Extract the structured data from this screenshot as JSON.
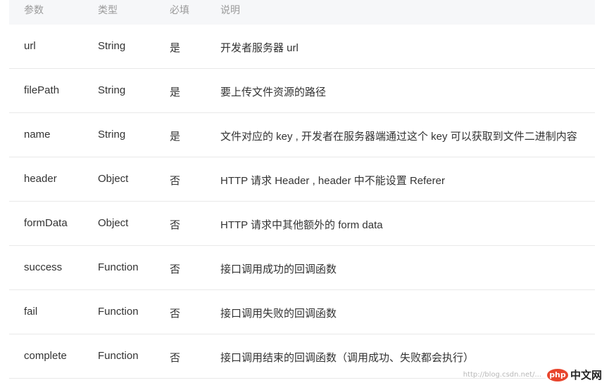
{
  "headers": [
    "参数",
    "类型",
    "必填",
    "说明"
  ],
  "rows": [
    [
      "url",
      "String",
      "是",
      "开发者服务器 url"
    ],
    [
      "filePath",
      "String",
      "是",
      "要上传文件资源的路径"
    ],
    [
      "name",
      "String",
      "是",
      "文件对应的 key , 开发者在服务器端通过这个 key 可以获取到文件二进制内容"
    ],
    [
      "header",
      "Object",
      "否",
      "HTTP 请求 Header , header 中不能设置 Referer"
    ],
    [
      "formData",
      "Object",
      "否",
      "HTTP 请求中其他额外的 form data"
    ],
    [
      "success",
      "Function",
      "否",
      "接口调用成功的回调函数"
    ],
    [
      "fail",
      "Function",
      "否",
      "接口调用失败的回调函数"
    ],
    [
      "complete",
      "Function",
      "否",
      "接口调用结束的回调函数（调用成功、失败都会执行）"
    ]
  ],
  "watermark": {
    "url": "http://blog.csdn.net/...",
    "logo_badge": "php",
    "logo_text": "中文网"
  },
  "colors": {
    "header_bg": "#f6f7f9",
    "header_text": "#9a9a9a",
    "body_text": "#333333",
    "divider": "#e9e9e9",
    "logo_red": "#e8452d"
  }
}
